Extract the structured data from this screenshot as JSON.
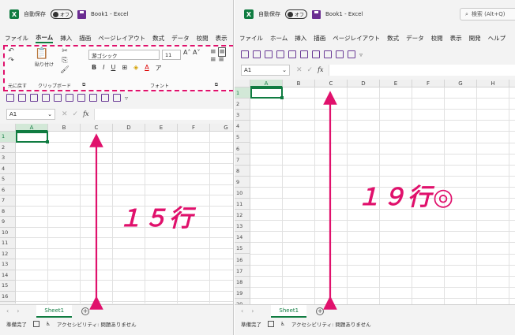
{
  "colors": {
    "accent": "#e0116c",
    "excel_green": "#107c41"
  },
  "app": {
    "autosave_label": "自動保存",
    "autosave_state": "オフ",
    "doc_title": "Book1 - Excel",
    "search_placeholder": "検索 (Alt+Q)"
  },
  "left": {
    "menu": [
      "ファイル",
      "ホーム",
      "挿入",
      "描画",
      "ページレイアウト",
      "数式",
      "データ",
      "校閲",
      "表示",
      "開"
    ],
    "active_menu_index": 1,
    "ribbon": {
      "paste_label": "貼り付け",
      "font_name": "游ゴシック",
      "font_size": "11",
      "group_undo": "元に戻す",
      "group_clipboard": "クリップボード",
      "group_font": "フォント"
    },
    "namebox": "A1",
    "columns": [
      "A",
      "B",
      "C",
      "D",
      "E",
      "F",
      "G"
    ],
    "rows": [
      "1",
      "2",
      "3",
      "4",
      "5",
      "6",
      "7",
      "8",
      "9",
      "10",
      "11",
      "12",
      "13",
      "14",
      "15",
      "16"
    ],
    "sheet_tab": "Sheet1",
    "status_ready": "準備完了",
    "status_accessibility": "アクセシビリティ: 問題ありません",
    "annotation": "１５行"
  },
  "right": {
    "menu": [
      "ファイル",
      "ホーム",
      "挿入",
      "描画",
      "ページレイアウト",
      "数式",
      "データ",
      "校閲",
      "表示",
      "開発",
      "ヘルプ"
    ],
    "namebox": "A1",
    "columns": [
      "A",
      "B",
      "C",
      "D",
      "E",
      "F",
      "G",
      "H"
    ],
    "rows": [
      "1",
      "2",
      "3",
      "4",
      "5",
      "6",
      "7",
      "8",
      "9",
      "10",
      "11",
      "12",
      "13",
      "14",
      "15",
      "16",
      "17",
      "18",
      "19",
      "20"
    ],
    "sheet_tab": "Sheet1",
    "status_ready": "準備完了",
    "status_accessibility": "アクセシビリティ: 問題ありません",
    "annotation": "１９行◎"
  }
}
